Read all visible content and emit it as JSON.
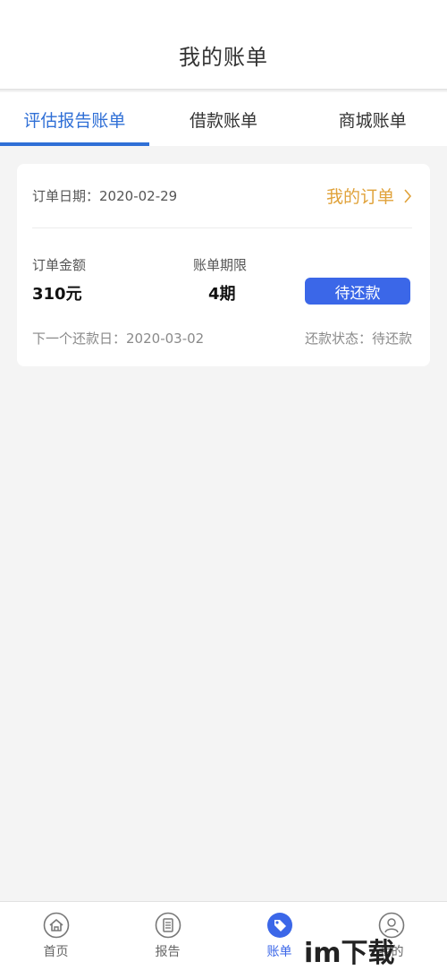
{
  "header": {
    "title": "我的账单"
  },
  "tabs": [
    {
      "label": "评估报告账单",
      "active": true
    },
    {
      "label": "借款账单",
      "active": false
    },
    {
      "label": "商城账单",
      "active": false
    }
  ],
  "bill_card": {
    "order_date_label": "订单日期：",
    "order_date": "2020-02-29",
    "my_orders_link": "我的订单",
    "amount_label": "订单金额",
    "amount_value": "310元",
    "term_label": "账单期限",
    "term_value": "4期",
    "pay_button": "待还款",
    "next_due_label": "下一个还款日：",
    "next_due_date": "2020-03-02",
    "status_label": "还款状态：",
    "status_value": "待还款"
  },
  "bottom_nav": {
    "items": [
      {
        "label": "首页",
        "icon": "home-icon",
        "active": false
      },
      {
        "label": "报告",
        "icon": "report-icon",
        "active": false
      },
      {
        "label": "账单",
        "icon": "tag-icon",
        "active": true
      },
      {
        "label": "我的",
        "icon": "user-icon",
        "active": false
      }
    ]
  },
  "watermark": {
    "text": "im下载"
  },
  "colors": {
    "primary": "#3b67e8",
    "tab_active": "#2f6fd6",
    "link_orange": "#e0a23a",
    "background": "#f4f4f4"
  }
}
